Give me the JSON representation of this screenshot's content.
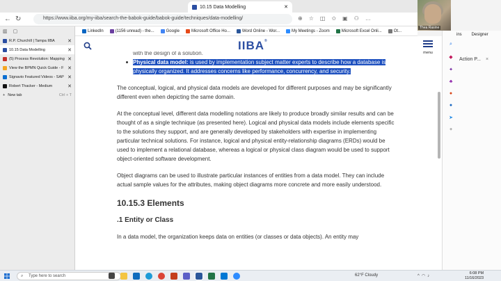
{
  "browser": {
    "active_tab_title": "10.15 Data Modelling",
    "url": "https://www.iiba.org/my-iiba/search-the-babok-guide/babok-guide/techniques/data-modelling/",
    "bookmarks": [
      {
        "label": "LinkedIn",
        "color": "#0a66c2"
      },
      {
        "label": "(1156 unread) - the...",
        "color": "#6b3fa0"
      },
      {
        "label": "Google",
        "color": "#4285f4"
      },
      {
        "label": "Microsoft Office Ho...",
        "color": "#e64a19"
      },
      {
        "label": "Word Online - Wor...",
        "color": "#2b579a"
      },
      {
        "label": "My Meetings - Zoom",
        "color": "#2d8cff"
      },
      {
        "label": "Microsoft Excel Onli...",
        "color": "#217346"
      },
      {
        "label": "Ot...",
        "color": "#777777"
      }
    ]
  },
  "vertical_tabs": {
    "tabs": [
      {
        "title": "R.P. Churchill | Tampa IIBA",
        "color": "#2b4ea2",
        "active": false
      },
      {
        "title": "10.15 Data Modelling",
        "color": "#2b4ea2",
        "active": true
      },
      {
        "title": "(5) Process Revolution: Mapping",
        "color": "#c4302b",
        "active": false
      },
      {
        "title": "View the BPMN Quick Guide - F",
        "color": "#f5a623",
        "active": false
      },
      {
        "title": "Signavio Featured Videos - SAP",
        "color": "#0a6ed1",
        "active": false
      },
      {
        "title": "Robert Thacker - Medium",
        "color": "#111111",
        "active": false
      }
    ],
    "new_tab_label": "New tab",
    "new_tab_shortcut": "Ctrl + T"
  },
  "site": {
    "logo_text": "IIBA",
    "menu_label": "menu"
  },
  "article": {
    "cutoff_line": "with the design of a solution.",
    "bullet_label": "Physical data model:",
    "bullet_text": " is used by implementation subject matter experts to describe how a database is physically organized. It addresses concerns like performance, concurrency, and security.",
    "p1": "The conceptual, logical, and physical data models are developed for different purposes and may be significantly different even when depicting the same domain.",
    "p2": "At the conceptual level, different data modelling notations are likely to produce broadly similar results and can be thought of as a single technique (as presented here). Logical and physical data models include elements specific to the solutions they support, and are generally developed by stakeholders with expertise in implementing particular technical solutions. For instance, logical and physical entity-relationship diagrams (ERDs) would be used to implement a relational database, whereas a logical or physical class diagram would be used to support object-oriented software development.",
    "p3": "Object diagrams can be used to illustrate particular instances of entities from a data model. They can include actual sample values for the attributes, making object diagrams more concrete and more easily understood.",
    "section_heading": "10.15.3  Elements",
    "sub_heading": ".1   Entity or Class",
    "p4": "In a data model, the organization keeps data on entities (or classes or data objects). An entity may"
  },
  "meeting": {
    "participant_name": "Thea Rasine"
  },
  "right_panel": {
    "tab1": "ins",
    "tab2": "Designer",
    "label": "Action P...",
    "label_extra": "×"
  },
  "taskbar": {
    "search_placeholder": "Type here to search",
    "weather": "62°F  Cloudy",
    "time": "6:08 PM",
    "date": "11/16/2023"
  }
}
